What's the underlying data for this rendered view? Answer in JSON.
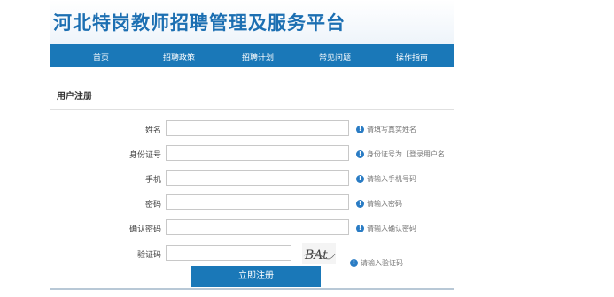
{
  "header": {
    "title": "河北特岗教师招聘管理及服务平台"
  },
  "nav": {
    "items": [
      "首页",
      "招聘政策",
      "招聘计划",
      "常见问题",
      "操作指南"
    ]
  },
  "form": {
    "section_title": "用户注册",
    "fields": [
      {
        "label": "姓名",
        "hint": "请填写真实姓名",
        "value": ""
      },
      {
        "label": "身份证号",
        "hint": "身份证号为【登录用户名",
        "value": ""
      },
      {
        "label": "手机",
        "hint": "请输入手机号码",
        "value": ""
      },
      {
        "label": "密码",
        "hint": "请输入密码",
        "value": ""
      },
      {
        "label": "确认密码",
        "hint": "请输入确认密码",
        "value": ""
      },
      {
        "label": "验证码",
        "hint": "请输入验证码",
        "value": ""
      }
    ],
    "captcha_text": "BAt",
    "submit_label": "立即注册"
  },
  "colors": {
    "primary": "#1a78b8",
    "title": "#1c6fb2",
    "icon": "#2a7cc4"
  }
}
